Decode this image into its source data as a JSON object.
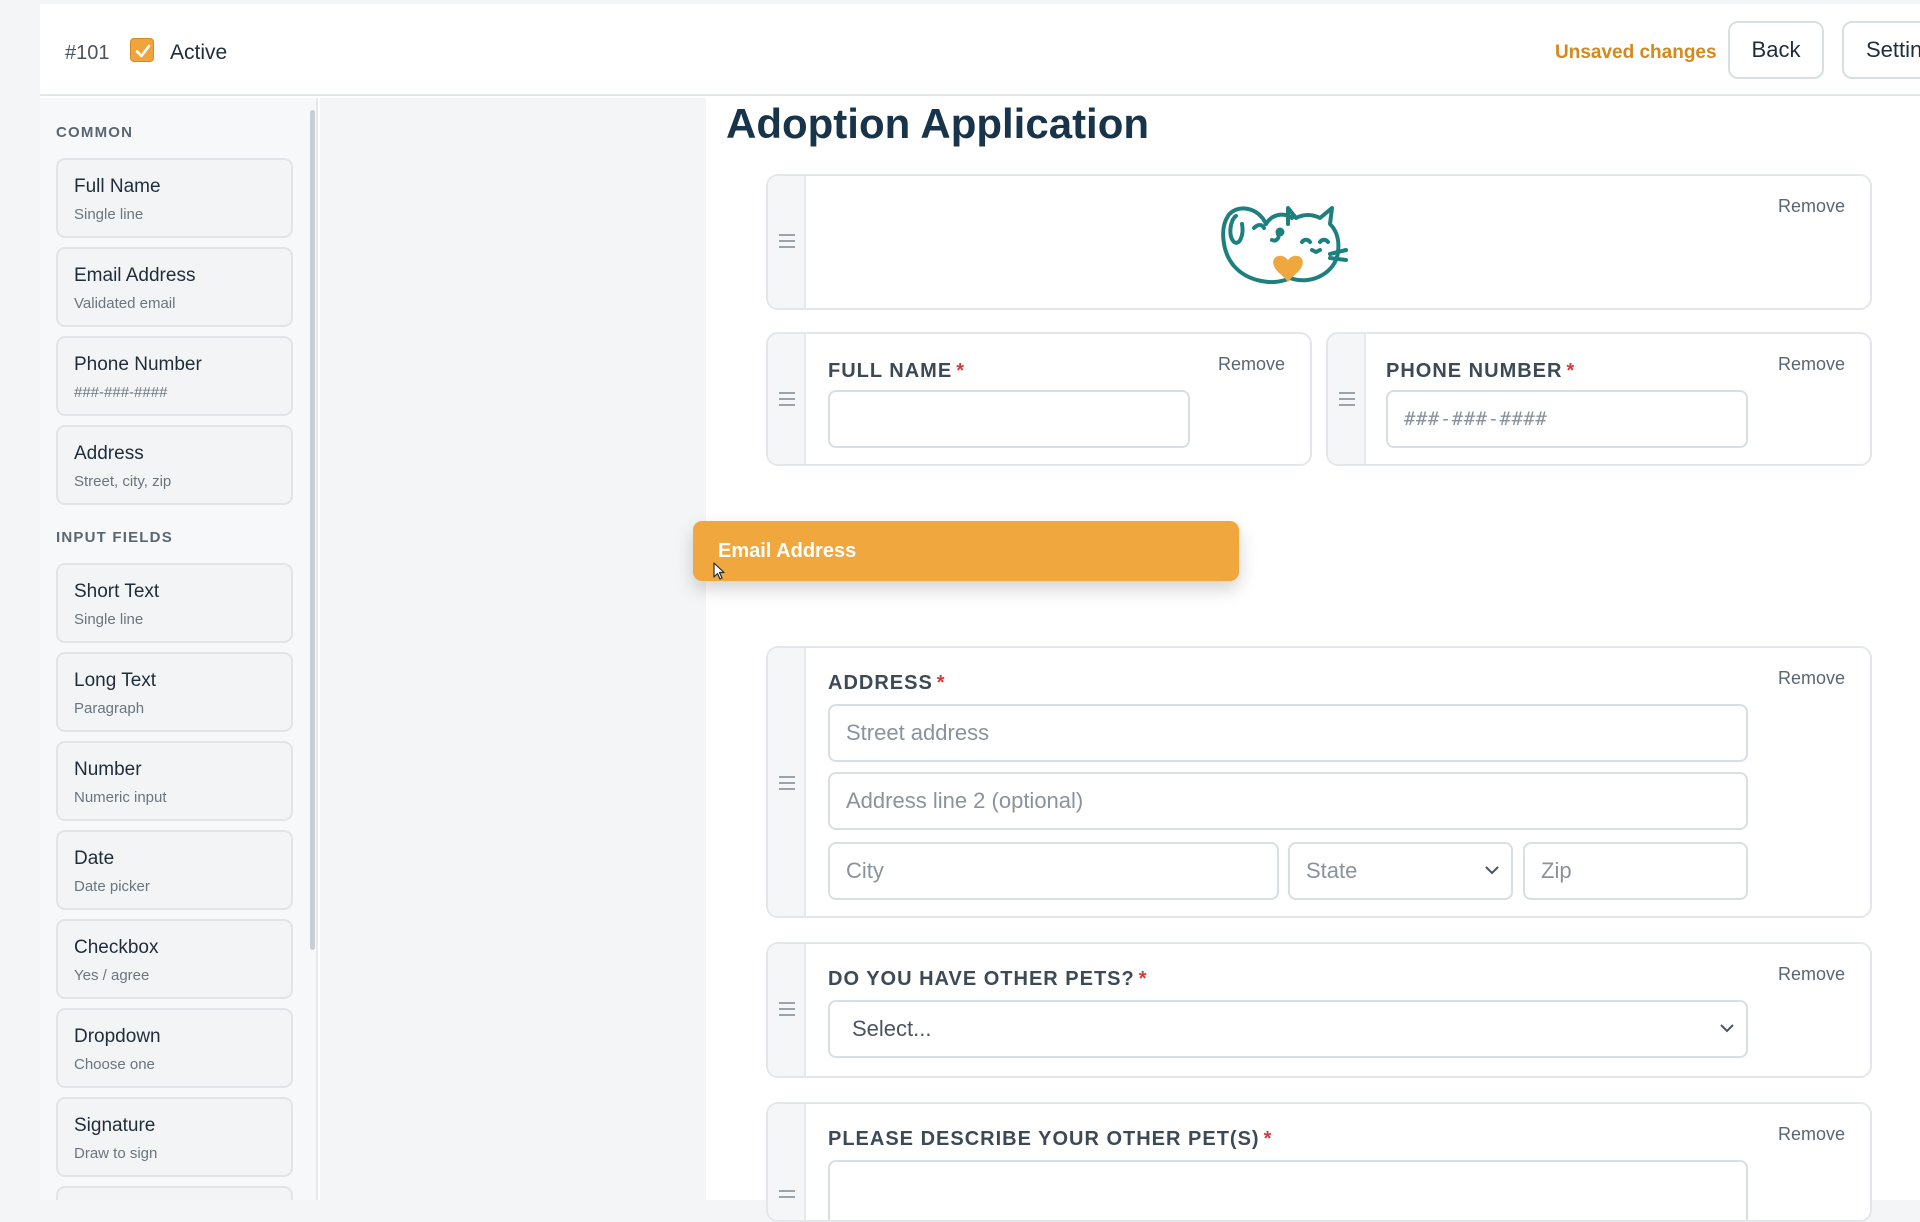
{
  "header": {
    "form_id": "#101",
    "active_label": "Active",
    "active_checked": true,
    "unsaved": "Unsaved changes",
    "back_label": "Back",
    "settings_label": "Settin"
  },
  "sidebar": {
    "sections": [
      {
        "title": "COMMON",
        "items": [
          {
            "title": "Full Name",
            "subtitle": "Single line"
          },
          {
            "title": "Email Address",
            "subtitle": "Validated email"
          },
          {
            "title": "Phone Number",
            "subtitle": "###-###-####"
          },
          {
            "title": "Address",
            "subtitle": "Street, city, zip"
          }
        ]
      },
      {
        "title": "INPUT FIELDS",
        "items": [
          {
            "title": "Short Text",
            "subtitle": "Single line"
          },
          {
            "title": "Long Text",
            "subtitle": "Paragraph"
          },
          {
            "title": "Number",
            "subtitle": "Numeric input"
          },
          {
            "title": "Date",
            "subtitle": "Date picker"
          },
          {
            "title": "Checkbox",
            "subtitle": "Yes / agree"
          },
          {
            "title": "Dropdown",
            "subtitle": "Choose one"
          },
          {
            "title": "Signature",
            "subtitle": "Draw to sign"
          }
        ]
      }
    ]
  },
  "form": {
    "title": "Adoption Application",
    "remove_label": "Remove",
    "logo_icon": "pet-logo-dog-cat-heart",
    "fields": {
      "full_name": {
        "label": "FULL NAME",
        "required": "*",
        "value": ""
      },
      "phone": {
        "label": "PHONE NUMBER",
        "required": "*",
        "placeholder": "###-###-####"
      },
      "address": {
        "label": "ADDRESS",
        "required": "*",
        "street_placeholder": "Street address",
        "line2_placeholder": "Address line 2 (optional)",
        "city_placeholder": "City",
        "state_placeholder": "State",
        "zip_placeholder": "Zip"
      },
      "other_pets": {
        "label": "DO YOU HAVE OTHER PETS?",
        "required": "*",
        "selected": "Select..."
      },
      "describe_pets": {
        "label": "PLEASE DESCRIBE YOUR OTHER PET(S)",
        "required": "*"
      }
    }
  },
  "drag": {
    "label": "Email Address"
  },
  "colors": {
    "accent": "#f0a73e",
    "title": "#17344a",
    "unsaved": "#d4891a",
    "required": "#d43a3a",
    "logo": "#1e7f7f"
  }
}
